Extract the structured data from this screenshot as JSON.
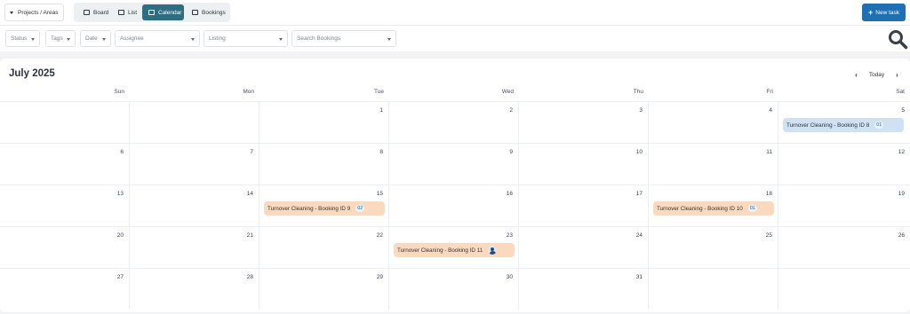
{
  "toolbar": {
    "project_label": "Projects / Areas",
    "views": [
      {
        "label": "Board",
        "icon": "board-icon",
        "active": false
      },
      {
        "label": "List",
        "icon": "list-icon",
        "active": false
      },
      {
        "label": "Calendar",
        "icon": "calendar-icon",
        "active": true
      },
      {
        "label": "Bookings",
        "icon": "calendar-icon",
        "active": false
      }
    ],
    "new_task_label": "New task",
    "accent": "#1f6fb3",
    "active_view_color": "#2e6d82"
  },
  "filters": {
    "status": "Status",
    "tags": "Tags",
    "date": "Date",
    "assignee": "Assignee",
    "listing": "Listing",
    "search": "Search Bookings"
  },
  "calendar": {
    "month_title": "July 2025",
    "today_label": "Today",
    "weekdays": [
      "Sun",
      "Mon",
      "Tue",
      "Wed",
      "Thu",
      "Fri",
      "Sat"
    ],
    "weeks": [
      [
        "",
        "",
        "1",
        "2",
        "3",
        "4",
        "5"
      ],
      [
        "6",
        "7",
        "8",
        "9",
        "10",
        "11",
        "12"
      ],
      [
        "13",
        "14",
        "15",
        "16",
        "17",
        "18",
        "19"
      ],
      [
        "20",
        "21",
        "22",
        "23",
        "24",
        "25",
        "26"
      ],
      [
        "27",
        "28",
        "29",
        "30",
        "31",
        "",
        ""
      ]
    ],
    "events": [
      {
        "title": "Turnover Cleaning - Booking ID 8",
        "badge": "01",
        "color": "blue",
        "date": "5"
      },
      {
        "title": "Turnover Cleaning - Booking ID 9",
        "badge": "02",
        "color": "orange",
        "date": "15"
      },
      {
        "title": "Turnover Cleaning - Booking ID 10",
        "badge": "01",
        "color": "orange",
        "date": "18"
      },
      {
        "title": "Turnover Cleaning - Booking ID 11",
        "badge": "",
        "color": "orange",
        "date": "23",
        "avatar": true
      }
    ]
  }
}
